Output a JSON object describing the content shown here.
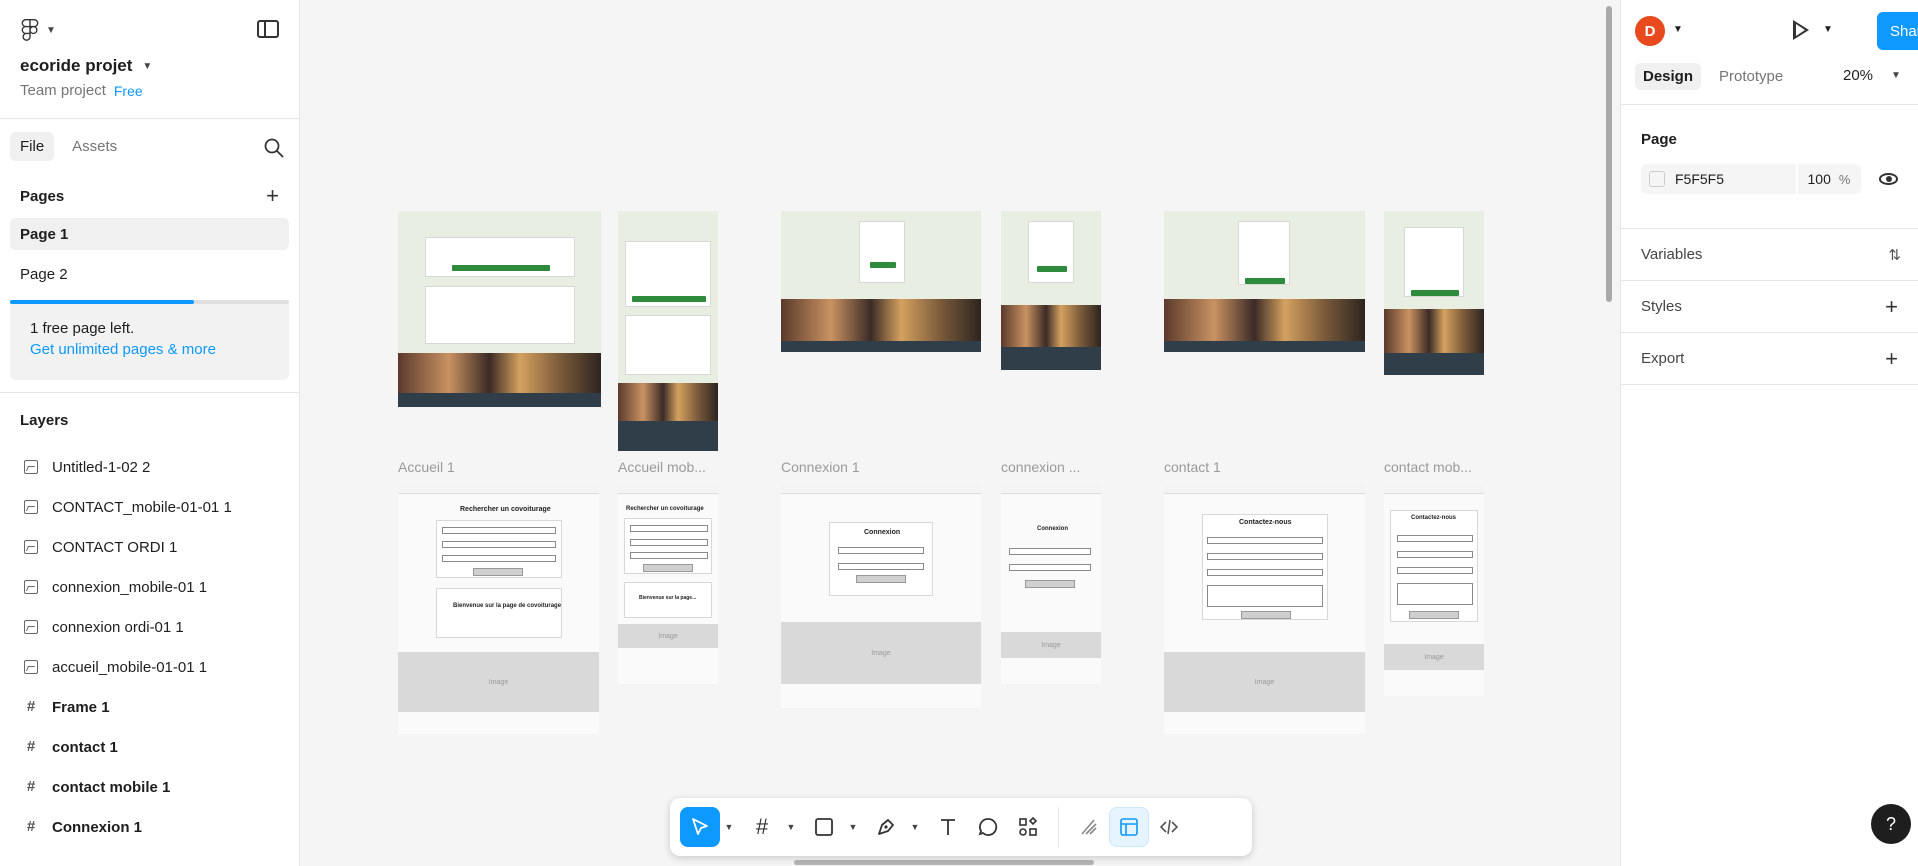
{
  "left_panel": {
    "project_name": "ecoride projet",
    "team_label": "Team project",
    "plan_badge": "Free",
    "tabs": [
      "File",
      "Assets"
    ],
    "pages_title": "Pages",
    "pages": [
      "Page 1",
      "Page 2"
    ],
    "upsell": {
      "text": "1 free page left.",
      "link": "Get unlimited pages & more",
      "progress": 0.66
    },
    "layers_title": "Layers",
    "layers": [
      {
        "name": "Untitled-1-02 2",
        "type": "image"
      },
      {
        "name": "CONTACT_mobile-01-01 1",
        "type": "image"
      },
      {
        "name": "CONTACT ORDI 1",
        "type": "image"
      },
      {
        "name": "connexion_mobile-01 1",
        "type": "image"
      },
      {
        "name": "connexion ordi-01 1",
        "type": "image"
      },
      {
        "name": "accueil_mobile-01-01 1",
        "type": "image"
      },
      {
        "name": "Frame 1",
        "type": "frame"
      },
      {
        "name": "contact 1",
        "type": "frame"
      },
      {
        "name": "contact mobile 1",
        "type": "frame"
      },
      {
        "name": "Connexion 1",
        "type": "frame"
      }
    ]
  },
  "right_panel": {
    "avatar_initial": "D",
    "share_label": "Share",
    "tabs": [
      "Design",
      "Prototype"
    ],
    "zoom": "20%",
    "page_section_title": "Page",
    "page_color": "F5F5F5",
    "page_opacity": "100",
    "percent_sign": "%",
    "sections": [
      "Variables",
      "Styles",
      "Export"
    ],
    "help_label": "?"
  },
  "canvas": {
    "frame_labels": [
      "Accueil 1",
      "Accueil mob...",
      "Connexion 1",
      "connexion ...",
      "contact 1",
      "contact mob..."
    ],
    "wireframe_texts": {
      "search_title": "Rechercher un covoiturage",
      "welcome_title": "Bienvenue sur la page de covoiturage",
      "welcome_short": "Bienvenue sur la page...",
      "connexion_title": "Connexion",
      "contact_title": "Contactez-nous",
      "image_label": "Image"
    }
  },
  "colors": {
    "accent": "#0d99ff",
    "avatar": "#e8491d",
    "eco_green": "#2e8b3e"
  },
  "toolbar": {
    "tools": [
      "move-tool",
      "frame-tool",
      "shape-tool",
      "pen-tool",
      "text-tool",
      "comment-tool",
      "actions-tool",
      "draw-mode",
      "design-mode",
      "dev-mode"
    ]
  }
}
